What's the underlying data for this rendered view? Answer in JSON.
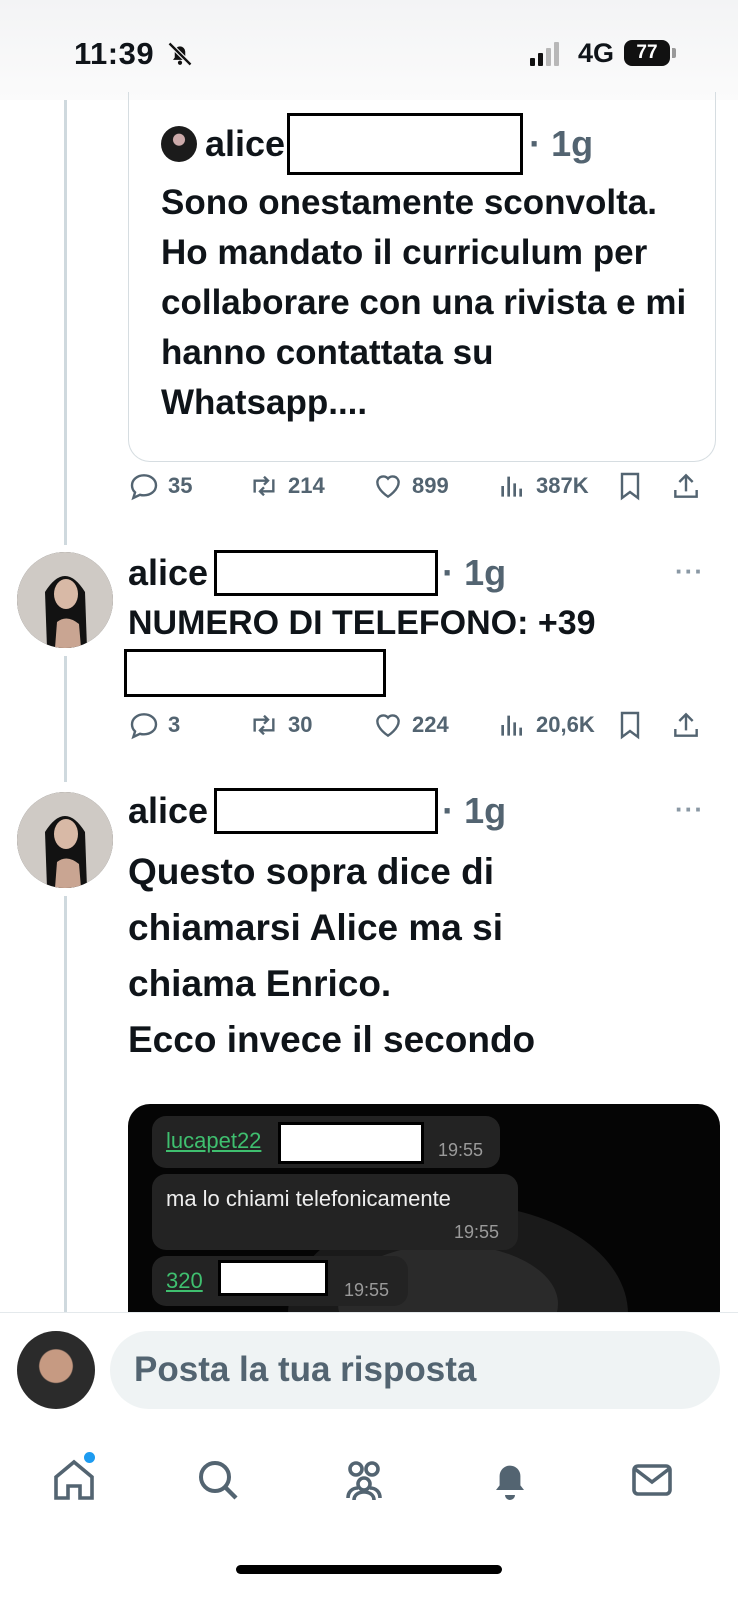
{
  "status_bar": {
    "time": "11:39",
    "network": "4G",
    "battery": "77"
  },
  "quoted_post": {
    "author": "alice",
    "time": "· 1g",
    "text": "Sono onestamente sconvolta. Ho mandato il curriculum per collaborare con una rivista e mi hanno contattata su Whatsapp...."
  },
  "actions_1": {
    "replies": "35",
    "reposts": "214",
    "likes": "899",
    "views": "387K"
  },
  "post_1": {
    "author": "alice",
    "time": "· 1g",
    "more": "···",
    "text": "NUMERO DI TELEFONO: +39"
  },
  "actions_2": {
    "replies": "3",
    "reposts": "30",
    "likes": "224",
    "views": "20,6K"
  },
  "post_2": {
    "author": "alice",
    "time": "· 1g",
    "more": "···",
    "lines": [
      "Questo sopra dice di",
      "chiamarsi Alice ma si",
      "chiama Enrico.",
      "Ecco invece il secondo"
    ]
  },
  "media": {
    "bubble1_link": "lucapet22",
    "bubble1_time": "19:55",
    "bubble2_text": "ma lo chiami telefonicamente",
    "bubble2_time": "19:55",
    "bubble3_link": "320",
    "bubble3_time": "19:55"
  },
  "composer": {
    "placeholder": "Posta la tua risposta"
  },
  "nav": {
    "items": [
      "home-icon",
      "search-icon",
      "communities-icon",
      "notifications-icon",
      "messages-icon"
    ]
  },
  "colors": {
    "accent": "#1d9bf0",
    "muted": "#536471",
    "whatsapp_link": "#3fbf6f"
  }
}
